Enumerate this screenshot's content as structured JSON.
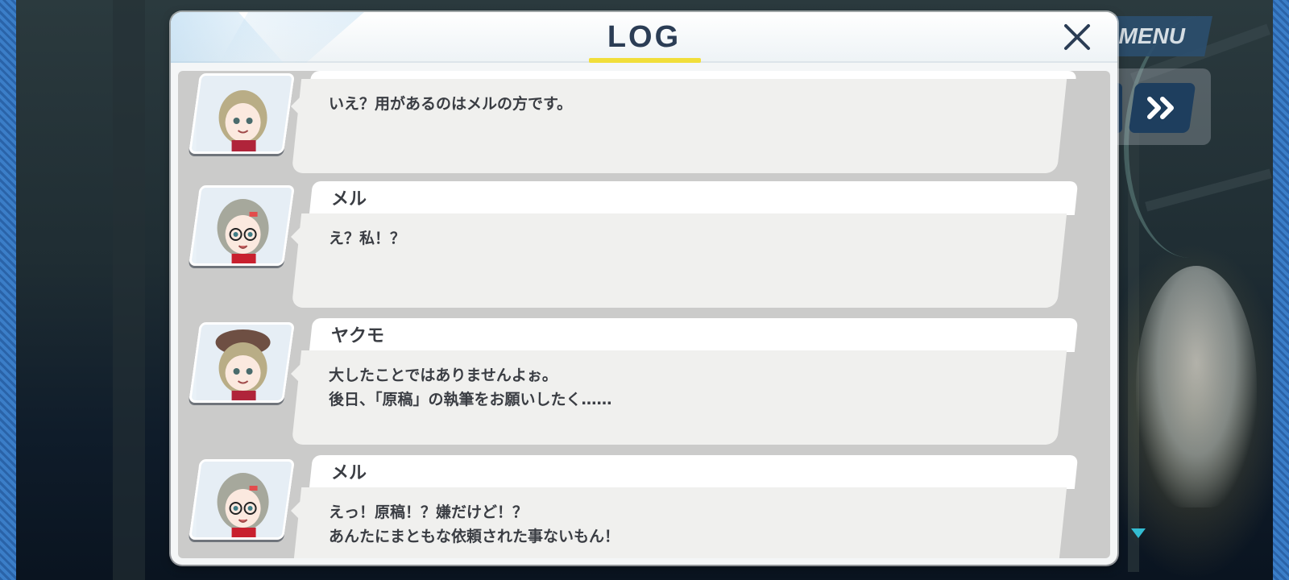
{
  "hud": {
    "menu_label": "MENU",
    "fast_forward_icon": "double-chevron-right-icon"
  },
  "dialog": {
    "title": "LOG",
    "close_icon": "close-icon"
  },
  "entries": [
    {
      "speaker": "",
      "portrait": "yakumo",
      "lines": [
        "いえ？用があるのはメルの方です。"
      ]
    },
    {
      "speaker": "メル",
      "portrait": "meru",
      "lines": [
        "え？私！？"
      ]
    },
    {
      "speaker": "ヤクモ",
      "portrait": "yakumo",
      "lines": [
        "大したことではありませんよぉ。",
        "後日、「原稿」の執筆をお願いしたく……"
      ]
    },
    {
      "speaker": "メル",
      "portrait": "meru",
      "lines": [
        "えっ！原稿！？嫌だけど！？",
        "あんたにまともな依頼された事ないもん！"
      ]
    }
  ],
  "colors": {
    "title": "#2b3d55",
    "underline": "#f1de3a",
    "menu_bg": "#2c4f6e",
    "ff_bg": "#1e3e5e"
  }
}
